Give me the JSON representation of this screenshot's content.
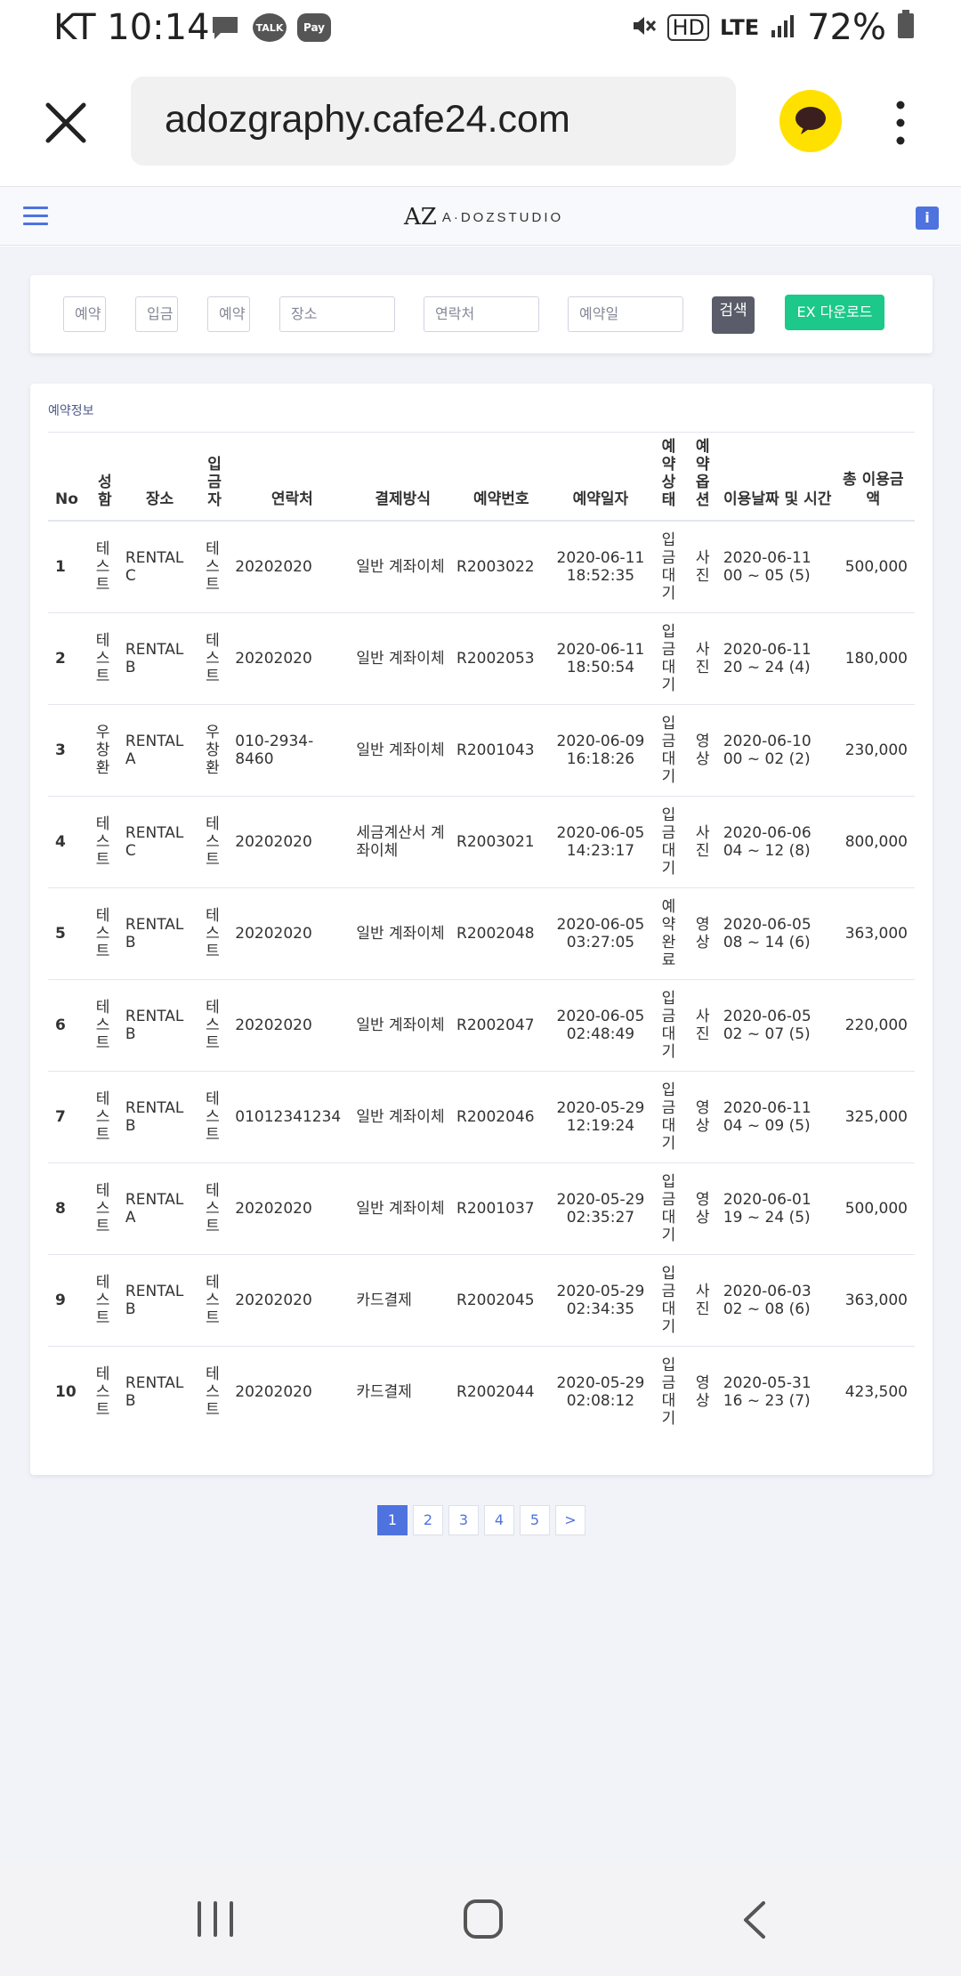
{
  "status_bar": {
    "carrier_time": "KT 10:14",
    "talk_label": "TALK",
    "pay_label": "Pay",
    "hd_label": "HD",
    "lte_label": "LTE",
    "battery": "72%"
  },
  "browser": {
    "url": "adozgraphy.cafe24.com"
  },
  "site": {
    "logo_mark": "AZ",
    "logo_text": "A·DOZSTUDIO",
    "info_icon_label": "i"
  },
  "search": {
    "fields": [
      "예약",
      "입금",
      "예약",
      "장소",
      "연락처",
      "예약일"
    ],
    "search_label": "검색",
    "export_label": "EX 다운로드"
  },
  "table": {
    "title": "예약정보",
    "headers": [
      "No",
      "성함",
      "장소",
      "입금자",
      "연락처",
      "결제방식",
      "예약번호",
      "예약일자",
      "예약상태",
      "예약옵션",
      "이용날짜 및 시간",
      "총 이용금액"
    ],
    "rows": [
      {
        "no": "1",
        "name": "테스트",
        "place": "RENTAL C",
        "payer": "테스트",
        "contact": "20202020",
        "payment": "일반 계좌이체",
        "resno": "R2003022",
        "date": "2020-06-11 18:52:35",
        "status": "입금대기",
        "option": "사진",
        "use": "2020-06-11 00 ~ 05 (5)",
        "amount": "500,000"
      },
      {
        "no": "2",
        "name": "테스트",
        "place": "RENTAL B",
        "payer": "테스트",
        "contact": "20202020",
        "payment": "일반 계좌이체",
        "resno": "R2002053",
        "date": "2020-06-11 18:50:54",
        "status": "입금대기",
        "option": "사진",
        "use": "2020-06-11 20 ~ 24 (4)",
        "amount": "180,000"
      },
      {
        "no": "3",
        "name": "우창환",
        "place": "RENTAL A",
        "payer": "우창환",
        "contact": "010-2934-8460",
        "payment": "일반 계좌이체",
        "resno": "R2001043",
        "date": "2020-06-09 16:18:26",
        "status": "입금대기",
        "option": "영상",
        "use": "2020-06-10 00 ~ 02 (2)",
        "amount": "230,000"
      },
      {
        "no": "4",
        "name": "테스트",
        "place": "RENTAL C",
        "payer": "테스트",
        "contact": "20202020",
        "payment": "세금계산서 계좌이체",
        "resno": "R2003021",
        "date": "2020-06-05 14:23:17",
        "status": "입금대기",
        "option": "사진",
        "use": "2020-06-06 04 ~ 12 (8)",
        "amount": "800,000"
      },
      {
        "no": "5",
        "name": "테스트",
        "place": "RENTAL B",
        "payer": "테스트",
        "contact": "20202020",
        "payment": "일반 계좌이체",
        "resno": "R2002048",
        "date": "2020-06-05 03:27:05",
        "status": "예약완료",
        "option": "영상",
        "use": "2020-06-05 08 ~ 14 (6)",
        "amount": "363,000"
      },
      {
        "no": "6",
        "name": "테스트",
        "place": "RENTAL B",
        "payer": "테스트",
        "contact": "20202020",
        "payment": "일반 계좌이체",
        "resno": "R2002047",
        "date": "2020-06-05 02:48:49",
        "status": "입금대기",
        "option": "사진",
        "use": "2020-06-05 02 ~ 07 (5)",
        "amount": "220,000"
      },
      {
        "no": "7",
        "name": "테스트",
        "place": "RENTAL B",
        "payer": "테스트",
        "contact": "01012341234",
        "payment": "일반 계좌이체",
        "resno": "R2002046",
        "date": "2020-05-29 12:19:24",
        "status": "입금대기",
        "option": "영상",
        "use": "2020-06-11 04 ~ 09 (5)",
        "amount": "325,000"
      },
      {
        "no": "8",
        "name": "테스트",
        "place": "RENTAL A",
        "payer": "테스트",
        "contact": "20202020",
        "payment": "일반 계좌이체",
        "resno": "R2001037",
        "date": "2020-05-29 02:35:27",
        "status": "입금대기",
        "option": "영상",
        "use": "2020-06-01 19 ~ 24 (5)",
        "amount": "500,000"
      },
      {
        "no": "9",
        "name": "테스트",
        "place": "RENTAL B",
        "payer": "테스트",
        "contact": "20202020",
        "payment": "카드결제",
        "resno": "R2002045",
        "date": "2020-05-29 02:34:35",
        "status": "입금대기",
        "option": "사진",
        "use": "2020-06-03 02 ~ 08 (6)",
        "amount": "363,000"
      },
      {
        "no": "10",
        "name": "테스트",
        "place": "RENTAL B",
        "payer": "테스트",
        "contact": "20202020",
        "payment": "카드결제",
        "resno": "R2002044",
        "date": "2020-05-29 02:08:12",
        "status": "입금대기",
        "option": "영상",
        "use": "2020-05-31 16 ~ 23 (7)",
        "amount": "423,500"
      }
    ]
  },
  "pagination": {
    "pages": [
      "1",
      "2",
      "3",
      "4",
      "5",
      ">"
    ],
    "active": "1"
  }
}
